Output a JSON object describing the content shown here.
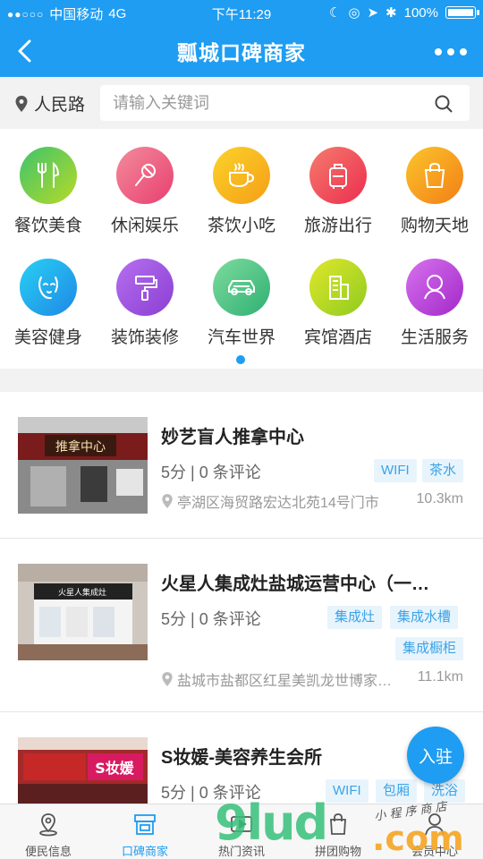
{
  "status_bar": {
    "carrier": "中国移动",
    "network": "4G",
    "time": "下午11:29",
    "battery": "100%"
  },
  "nav": {
    "title": "瓢城口碑商家"
  },
  "search": {
    "location": "人民路",
    "placeholder": "请输入关键词"
  },
  "categories": [
    {
      "label": "餐饮美食",
      "icon": "fork-knife-icon",
      "color": "#5cc862"
    },
    {
      "label": "休闲娱乐",
      "icon": "microphone-icon",
      "color": "#f0607a"
    },
    {
      "label": "茶饮小吃",
      "icon": "coffee-cup-icon",
      "color": "#f6b21e"
    },
    {
      "label": "旅游出行",
      "icon": "luggage-icon",
      "color": "#f5485c"
    },
    {
      "label": "购物天地",
      "icon": "shopping-bag-icon",
      "color": "#f7a11b"
    },
    {
      "label": "美容健身",
      "icon": "face-icon",
      "color": "#2eb4f0"
    },
    {
      "label": "装饰装修",
      "icon": "paint-roller-icon",
      "color": "#a152d8"
    },
    {
      "label": "汽车世界",
      "icon": "car-icon",
      "color": "#3fbf8a"
    },
    {
      "label": "宾馆酒店",
      "icon": "building-icon",
      "color": "#b9d51c"
    },
    {
      "label": "生活服务",
      "icon": "person-icon",
      "color": "#c54ad8"
    }
  ],
  "merchants": [
    {
      "name": "妙艺盲人推拿中心",
      "rating": "5分 | 0 条评论",
      "tags": [
        "WIFI",
        "茶水"
      ],
      "address": "亭湖区海贸路宏达北苑14号门市",
      "distance": "10.3km"
    },
    {
      "name": "火星人集成灶盐城运营中心（一…",
      "rating": "5分 | 0 条评论",
      "tags": [
        "集成灶",
        "集成水槽",
        "集成橱柜"
      ],
      "address": "盐城市盐都区红星美凯龙世博家…",
      "distance": "11.1km"
    },
    {
      "name": "S妆媛-美容养生会所",
      "rating": "5分 | 0 条评论",
      "tags": [
        "WIFI",
        "包厢",
        "洗浴"
      ],
      "address": "",
      "distance": ""
    }
  ],
  "thumb_text": {
    "item1_sign": "推拿中心",
    "item2_sign": "火星人集成灶",
    "item3_sign": "S妆媛"
  },
  "fab": {
    "label": "入驻"
  },
  "tabs": [
    {
      "label": "便民信息",
      "icon": "location-pin-icon",
      "active": false
    },
    {
      "label": "口碑商家",
      "icon": "storefront-icon",
      "active": true
    },
    {
      "label": "热门资讯",
      "icon": "video-icon",
      "active": false
    },
    {
      "label": "拼团购物",
      "icon": "shopping-tag-icon",
      "active": false
    },
    {
      "label": "会员中心",
      "icon": "user-icon",
      "active": false
    }
  ],
  "watermark": {
    "main": "9lud",
    "com": ".com",
    "script": "小 程 序 商 店"
  },
  "colors": {
    "primary": "#1e9df2",
    "tag_text": "#3ba3e8",
    "tag_bg": "#e8f4fc"
  }
}
